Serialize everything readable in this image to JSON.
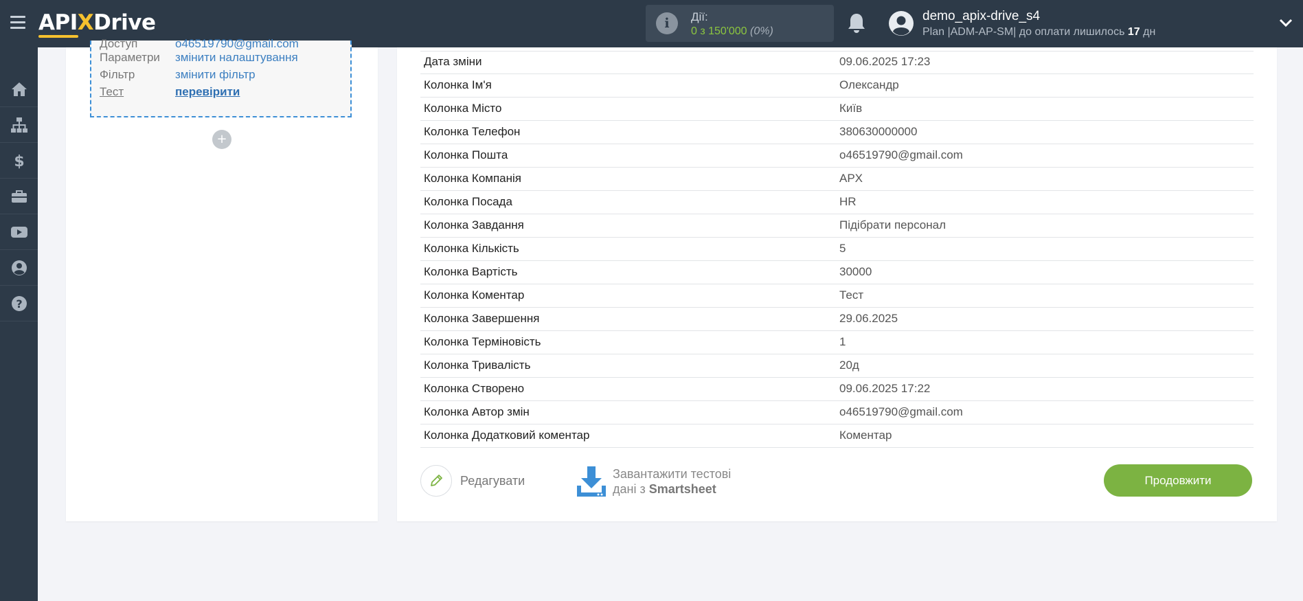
{
  "topbar": {
    "logo_api": "API",
    "logo_x": "X",
    "logo_drive": "Drive",
    "actions_label": "Дії:",
    "actions_value": "0 з 150'000",
    "actions_pct": "(0%)",
    "user_name": "demo_apix-drive_s4",
    "plan_prefix": "Plan |ADM-AP-SM| до оплати лишилось",
    "plan_days": "17",
    "plan_suffix": "дн"
  },
  "sidebar": {
    "items": [
      {
        "icon": "home-icon"
      },
      {
        "icon": "sitemap-icon"
      },
      {
        "icon": "dollar-icon"
      },
      {
        "icon": "briefcase-icon"
      },
      {
        "icon": "youtube-icon"
      },
      {
        "icon": "user-circle-icon"
      },
      {
        "icon": "help-icon"
      }
    ]
  },
  "left_panel": {
    "access_key": "Доступ",
    "access_value": "o46519790@gmail.com",
    "params_key": "Параметри",
    "params_value": "змінити налаштування",
    "filter_key": "Фільтр",
    "filter_value": "змінити фільтр",
    "test_key": "Тест",
    "test_value": "перевірити",
    "add_symbol": "+"
  },
  "table": {
    "rows": [
      {
        "field": "Дата зміни",
        "value": "09.06.2025 17:23"
      },
      {
        "field": "Колонка Ім'я",
        "value": "Олександр"
      },
      {
        "field": "Колонка Місто",
        "value": "Київ"
      },
      {
        "field": "Колонка Телефон",
        "value": "380630000000"
      },
      {
        "field": "Колонка Пошта",
        "value": "o46519790@gmail.com"
      },
      {
        "field": "Колонка Компанія",
        "value": "APX"
      },
      {
        "field": "Колонка Посада",
        "value": "HR"
      },
      {
        "field": "Колонка Завдання",
        "value": "Підібрати персонал"
      },
      {
        "field": "Колонка Кількість",
        "value": "5"
      },
      {
        "field": "Колонка Вартість",
        "value": "30000"
      },
      {
        "field": "Колонка Коментар",
        "value": "Тест"
      },
      {
        "field": "Колонка Завершення",
        "value": "29.06.2025"
      },
      {
        "field": "Колонка Терміновість",
        "value": "1"
      },
      {
        "field": "Колонка Тривалість",
        "value": "20д"
      },
      {
        "field": "Колонка Створено",
        "value": "09.06.2025 17:22"
      },
      {
        "field": "Колонка Автор змін",
        "value": "o46519790@gmail.com"
      },
      {
        "field": "Колонка Додатковий коментар",
        "value": "Коментар"
      }
    ]
  },
  "buttons": {
    "edit_label": "Редагувати",
    "download_line1": "Завантажити тестові",
    "download_line2_prefix": "дані з",
    "download_source": "Smartsheet",
    "continue_label": "Продовжити"
  },
  "colors": {
    "topbar_bg": "#2d3a48",
    "accent_green": "#7cb342",
    "link_blue": "#3c7fc1",
    "logo_yellow": "#f6c12e"
  }
}
